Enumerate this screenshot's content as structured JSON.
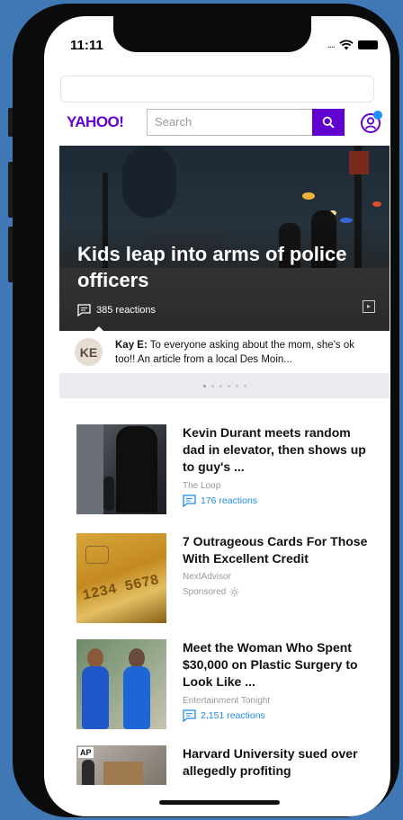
{
  "status_bar": {
    "time": "11:11",
    "signal": "...."
  },
  "header": {
    "logo": "YAHOO!",
    "search_placeholder": "Search"
  },
  "hero": {
    "title": "Kids leap into arms of police officers",
    "reactions": "385 reactions"
  },
  "comment": {
    "avatar_initials": "KE",
    "author": "Kay E:",
    "text": " To everyone asking about the mom, she's ok too!! An article from a local Des Moin..."
  },
  "stories": [
    {
      "title": "Kevin Durant meets random dad in elevator, then shows up to guy's ...",
      "source": "The Loop",
      "reactions": "176 reactions"
    },
    {
      "title": "7 Outrageous Cards For Those With Excellent Credit",
      "source": "NextAdvisor",
      "sponsored": "Sponsored"
    },
    {
      "title": "Meet the Woman Who Spent $30,000 on Plastic Surgery to Look Like ...",
      "source": "Entertainment Tonight",
      "reactions": "2,151 reactions"
    },
    {
      "title": "Harvard University sued over allegedly profiting",
      "thumb_badge": "AP"
    }
  ],
  "colors": {
    "brand": "#6001d2",
    "link": "#1d8be8",
    "notification": "#1e90ff"
  },
  "icons": [
    "search-icon",
    "account-icon",
    "comment-icon",
    "next-icon",
    "sponsored-info-icon"
  ]
}
